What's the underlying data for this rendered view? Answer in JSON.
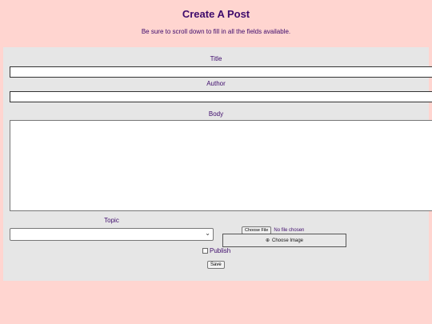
{
  "header": {
    "title": "Create A Post",
    "subtitle": "Be sure to scroll down to fill in all the fields available."
  },
  "form": {
    "title_label": "Title",
    "author_label": "Author",
    "body_label": "Body",
    "topic_label": "Topic",
    "file_button_label": "Choose File",
    "file_status": "No file chosen",
    "choose_image_label": "Choose Image",
    "choose_image_icon": "⊕",
    "publish_label": "Publish",
    "save_label": "Save"
  },
  "colors": {
    "background": "#ffd5d0",
    "panel": "#e6e6e6",
    "text": "#3d0a6b"
  }
}
